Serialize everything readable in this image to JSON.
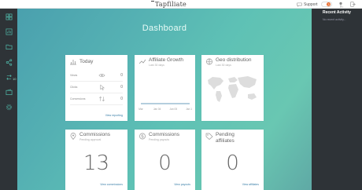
{
  "app": {
    "brand_first": "T",
    "brand_rest": "apfiliate"
  },
  "topbar": {
    "support_label": "Support",
    "notifications_count": "3"
  },
  "main": {
    "title": "Dashboard"
  },
  "sidebar": {
    "badge": "10"
  },
  "cards": {
    "today": {
      "title": "Today",
      "rows": [
        {
          "label": "Views",
          "value": "0"
        },
        {
          "label": "Clicks",
          "value": "0"
        },
        {
          "label": "Conversions",
          "value": "0"
        }
      ],
      "link": "View reporting"
    },
    "growth": {
      "title": "Affiliate Growth",
      "sub": "Last 30 days",
      "chart_data": {
        "type": "line",
        "x": [
          "Mar",
          "Jan 04",
          "Jan 05",
          "Jan 12"
        ],
        "series": [
          {
            "values": [
              0,
              0,
              0,
              0
            ]
          }
        ]
      }
    },
    "geo": {
      "title": "Geo distribution",
      "sub": "Last 30 days"
    },
    "commissions_pending": {
      "title": "Commissions",
      "sub": "Pending approval",
      "value": "13",
      "link": "View commissions"
    },
    "commissions_paid": {
      "title": "Commissions",
      "sub": "Pending payouts",
      "value": "0",
      "link": "View payouts"
    },
    "pending_affiliates": {
      "title": "Pending",
      "title2": "affiliates",
      "value": "0",
      "link": "View affiliates"
    }
  },
  "panel": {
    "title": "Recent Activity",
    "empty": "No recent activity..."
  },
  "colors": {
    "accent": "#5ec1b5",
    "sidebar": "#2e3337",
    "badge": "#e96a2b",
    "link": "#3a7fa8"
  }
}
